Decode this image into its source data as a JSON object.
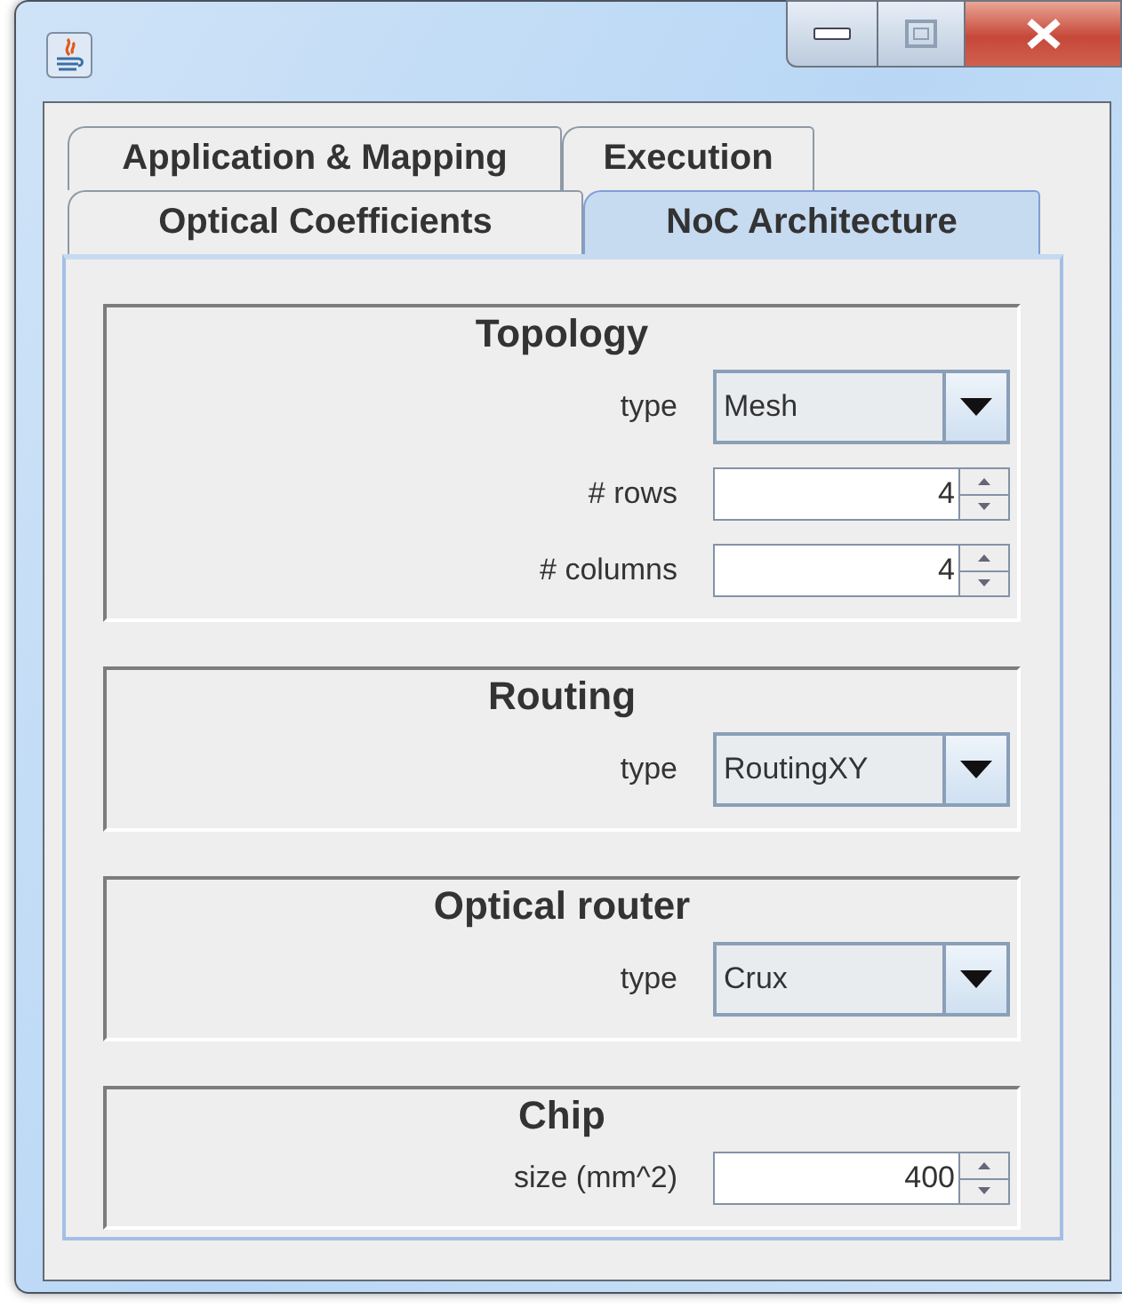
{
  "tab_rows": [
    {
      "tabs": [
        {
          "label": "Application & Mapping",
          "selected": false
        },
        {
          "label": "Execution",
          "selected": false
        }
      ]
    },
    {
      "tabs": [
        {
          "label": "Optical Coefficients",
          "selected": false
        },
        {
          "label": "NoC Architecture",
          "selected": true
        }
      ]
    }
  ],
  "sections": [
    {
      "title": "Topology",
      "fields": [
        {
          "kind": "combo",
          "label": "type",
          "value": "Mesh"
        },
        {
          "kind": "spinner",
          "label": "# rows",
          "value": "4"
        },
        {
          "kind": "spinner",
          "label": "# columns",
          "value": "4"
        }
      ]
    },
    {
      "title": "Routing",
      "fields": [
        {
          "kind": "combo",
          "label": "type",
          "value": "RoutingXY"
        }
      ]
    },
    {
      "title": "Optical router",
      "fields": [
        {
          "kind": "combo",
          "label": "type",
          "value": "Crux"
        }
      ]
    },
    {
      "title": "Chip",
      "fields": [
        {
          "kind": "spinner",
          "label": "size (mm^2)",
          "value": "400"
        }
      ]
    }
  ]
}
